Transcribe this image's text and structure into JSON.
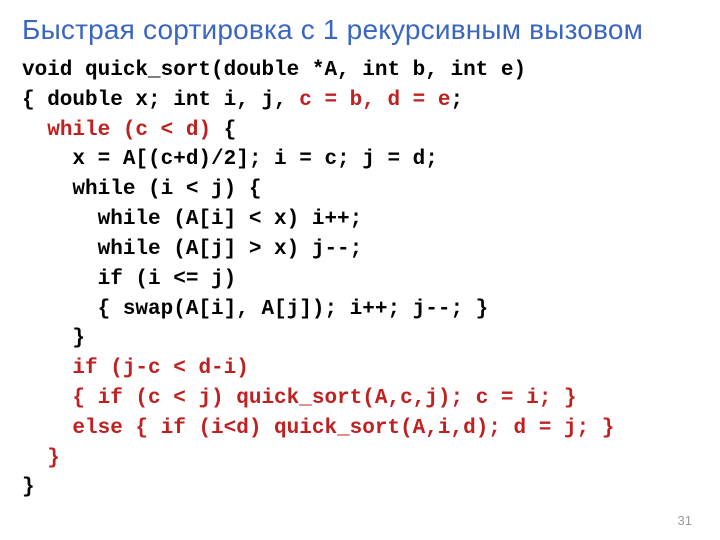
{
  "title": "Быстрая сортировка с 1 рекурсивным вызовом",
  "page_number": "31",
  "code": {
    "l1": "void quick_sort(double *A, int b, int e)",
    "l2a": "{ double x; int i, j, ",
    "l2b": "c = b, d = e",
    "l2c": ";",
    "l3a": "  ",
    "l3b": "while (c < d)",
    "l3c": " {",
    "l4": "    x = A[(c+d)/2]; i = c; j = d;",
    "l5": "    while (i < j) {",
    "l6": "      while (A[i] < x) i++;",
    "l7": "      while (A[j] > x) j--;",
    "l8": "      if (i <= j)",
    "l9": "      { swap(A[i], A[j]); i++; j--; }",
    "l10": "    }",
    "l11a": "    ",
    "l11b": "if (j-c < d-i)",
    "l12a": "    ",
    "l12b": "{ if (c < j) quick_sort(A,c,j); c = i; }",
    "l13a": "    ",
    "l13b": "else { if (i<d) quick_sort(A,i,d); d = j; }",
    "l14a": "  ",
    "l14b": "}",
    "l15": "}"
  }
}
